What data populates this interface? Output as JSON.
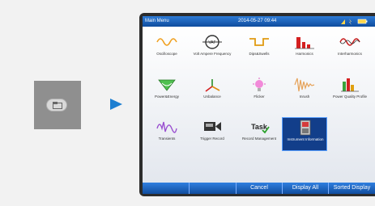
{
  "header": {
    "title": "Main Menu",
    "datetime": "2014-05-27 09:44"
  },
  "status_icons": [
    "battery-icon",
    "signal-icon",
    "lock-icon"
  ],
  "menu_items": [
    {
      "label": "Oscilloscope",
      "icon": "oscilloscope-icon"
    },
    {
      "label": "Volt Ampere Frequency",
      "icon": "vaf-meter-icon"
    },
    {
      "label": "Dips&Swells",
      "icon": "dips-swells-icon"
    },
    {
      "label": "Harmonics",
      "icon": "harmonics-icon"
    },
    {
      "label": "Interharmonics",
      "icon": "interharmonics-icon"
    },
    {
      "label": "Power&Energy",
      "icon": "power-energy-icon"
    },
    {
      "label": "Unbalance",
      "icon": "unbalance-icon"
    },
    {
      "label": "Flicker",
      "icon": "flicker-icon"
    },
    {
      "label": "Inrush",
      "icon": "inrush-icon"
    },
    {
      "label": "Power Quality Profile",
      "icon": "pq-profile-icon"
    },
    {
      "label": "Transients",
      "icon": "transients-icon"
    },
    {
      "label": "Trigger Record",
      "icon": "trigger-record-icon"
    },
    {
      "label": "Record Management",
      "icon": "task-icon"
    },
    {
      "label": "Instrument Information",
      "icon": "instrument-info-icon"
    }
  ],
  "selected_item": "Instrument Information",
  "function_keys": [
    "",
    "",
    "Cancel",
    "Display All",
    "Sorted Display"
  ],
  "colors": {
    "title_bar": "#1a5fb8",
    "accent_arrow": "#1e7fd1",
    "selected": "#123e8a"
  }
}
